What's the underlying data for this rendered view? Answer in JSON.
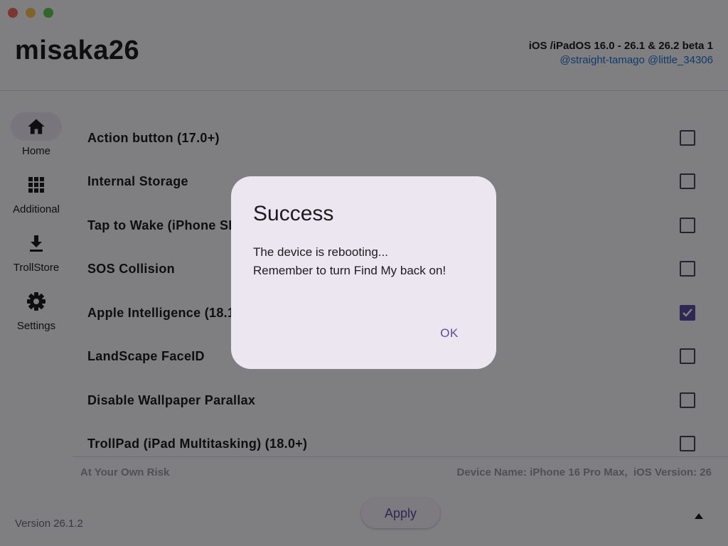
{
  "app": {
    "title": "misaka26",
    "ios_range": "iOS /iPadOS 16.0 - 26.1 & 26.2 beta 1",
    "credits": "@straight-tamago @little_34306"
  },
  "sidebar": {
    "items": [
      {
        "label": "Home",
        "icon": "home-icon",
        "active": true
      },
      {
        "label": "Additional",
        "icon": "grid-icon",
        "active": false
      },
      {
        "label": "TrollStore",
        "icon": "download-icon",
        "active": false
      },
      {
        "label": "Settings",
        "icon": "gear-icon",
        "active": false
      }
    ]
  },
  "tweaks": [
    {
      "label": "Action button (17.0+)",
      "checked": false
    },
    {
      "label": "Internal Storage",
      "checked": false
    },
    {
      "label": "Tap to Wake (iPhone SE)",
      "checked": false
    },
    {
      "label": "SOS Collision",
      "checked": false
    },
    {
      "label": "Apple Intelligence (18.1+)",
      "checked": true
    },
    {
      "label": "LandScape FaceID",
      "checked": false
    },
    {
      "label": "Disable Wallpaper Parallax",
      "checked": false
    },
    {
      "label": "TrollPad (iPad Multitasking) (18.0+)",
      "checked": false
    }
  ],
  "footer": {
    "risk": "At Your Own Risk",
    "device_info": "Device Name: iPhone 16 Pro Max,  iOS Version: 26",
    "version": "Version 26.1.2",
    "apply_label": "Apply"
  },
  "dialog": {
    "title": "Success",
    "line1": "The device is rebooting...",
    "line2": "Remember to turn Find My back on!",
    "ok_label": "OK"
  },
  "colors": {
    "accent": "#5b4d9d",
    "link": "#1e6fcf",
    "dialog_bg": "#ece6f0"
  }
}
